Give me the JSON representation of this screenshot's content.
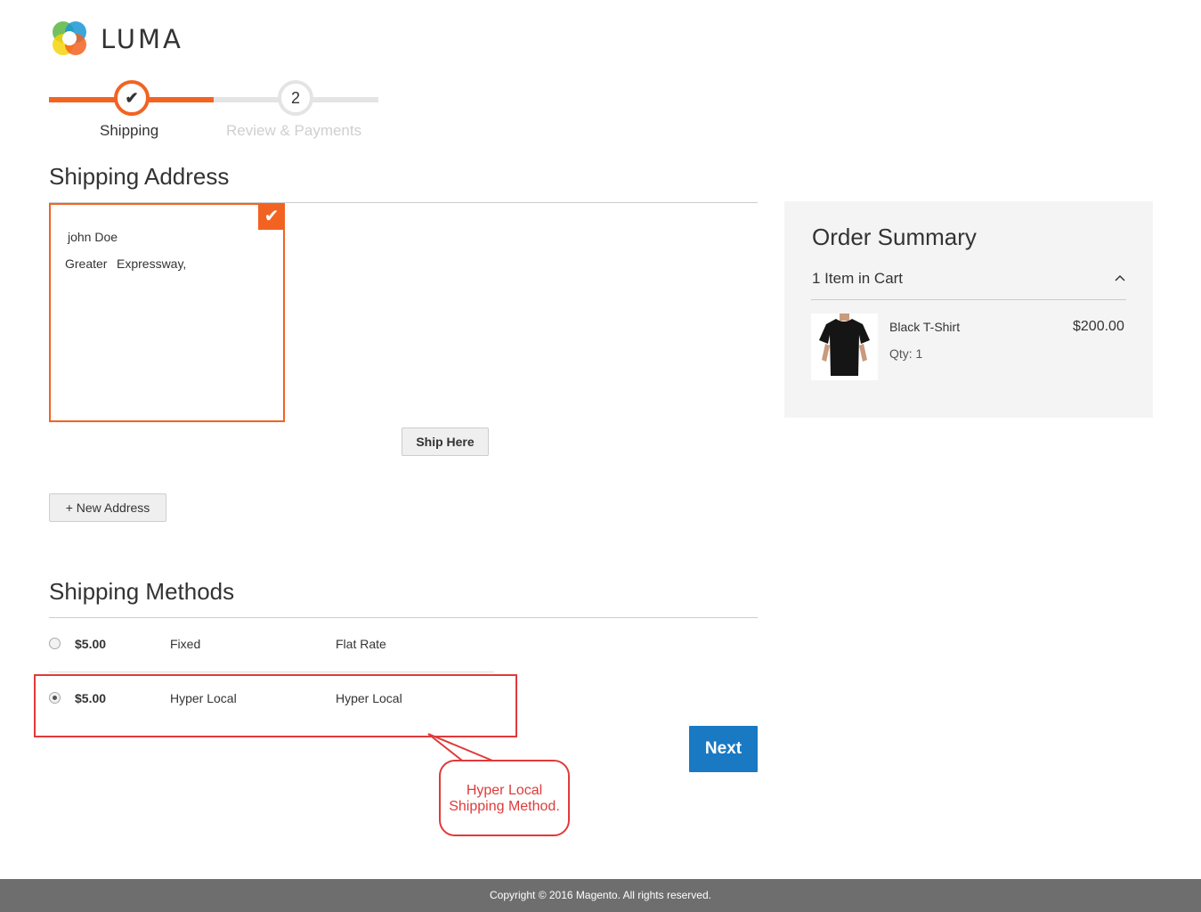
{
  "brand": {
    "name": "LUMA"
  },
  "progress": {
    "steps": [
      {
        "label": "Shipping",
        "marker": "✔",
        "state": "complete"
      },
      {
        "label": "Review & Payments",
        "marker": "2",
        "state": "upcoming"
      }
    ]
  },
  "shipping_address": {
    "title": "Shipping Address",
    "selected_card": {
      "name": "john Doe",
      "street_1": "Greater",
      "street_2": "Expressway,"
    },
    "ship_here_label": "Ship Here",
    "new_address_label": "+ New Address"
  },
  "shipping_methods": {
    "title": "Shipping Methods",
    "rows": [
      {
        "price": "$5.00",
        "method": "Fixed",
        "carrier": "Flat Rate",
        "selected": false
      },
      {
        "price": "$5.00",
        "method": "Hyper Local",
        "carrier": "Hyper Local",
        "selected": true
      }
    ],
    "next_label": "Next"
  },
  "annotation": {
    "line1": "Hyper Local",
    "line2": "Shipping Method."
  },
  "order_summary": {
    "title": "Order Summary",
    "items_label": "1 Item in Cart",
    "item": {
      "name": "Black T-Shirt",
      "qty": "Qty: 1",
      "price": "$200.00",
      "image_icon": "black-tshirt-photo"
    }
  },
  "footer": {
    "copyright": "Copyright © 2016 Magento. All rights reserved."
  },
  "colors": {
    "accent": "#f26322",
    "primary_button": "#1979c3",
    "annotation": "#e03a3a",
    "footer_bg": "#6e6e6e"
  }
}
